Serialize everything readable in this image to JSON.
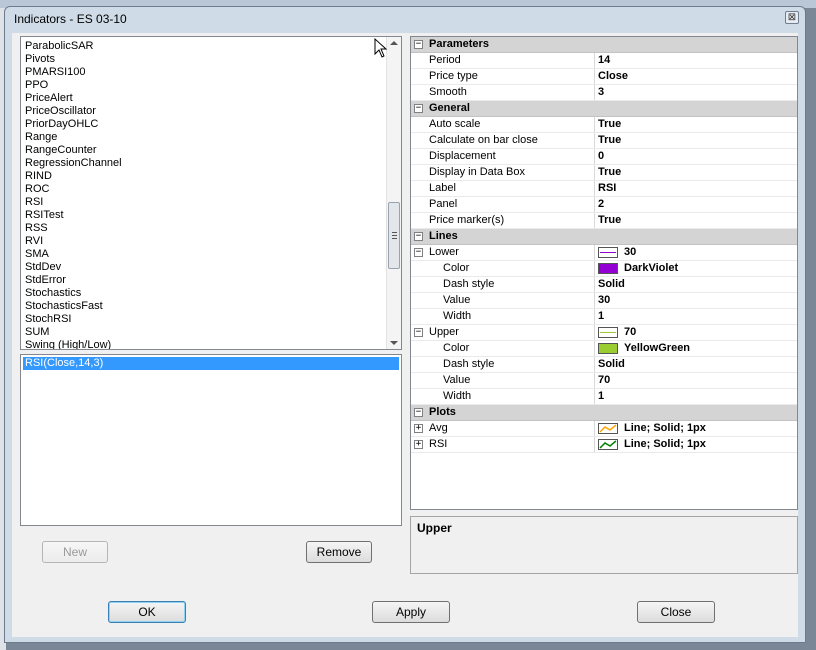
{
  "window": {
    "title": "Indicators - ES 03-10",
    "close_glyph": "⊠"
  },
  "indicator_list": [
    "ParabolicSAR",
    "Pivots",
    "PMARSI100",
    "PPO",
    "PriceAlert",
    "PriceOscillator",
    "PriorDayOHLC",
    "Range",
    "RangeCounter",
    "RegressionChannel",
    "RIND",
    "ROC",
    "RSI",
    "RSITest",
    "RSS",
    "RVI",
    "SMA",
    "StdDev",
    "StdError",
    "Stochastics",
    "StochasticsFast",
    "StochRSI",
    "SUM",
    "Swing (High/Low)"
  ],
  "applied": {
    "items": [
      "RSI(Close,14,3)"
    ]
  },
  "buttons": {
    "new": "New",
    "remove": "Remove",
    "ok": "OK",
    "apply": "Apply",
    "close": "Close"
  },
  "properties": {
    "parameters": {
      "label": "Parameters",
      "rows": [
        {
          "name": "Period",
          "value": "14"
        },
        {
          "name": "Price type",
          "value": "Close"
        },
        {
          "name": "Smooth",
          "value": "3"
        }
      ]
    },
    "general": {
      "label": "General",
      "rows": [
        {
          "name": "Auto scale",
          "value": "True"
        },
        {
          "name": "Calculate on bar close",
          "value": "True"
        },
        {
          "name": "Displacement",
          "value": "0"
        },
        {
          "name": "Display in Data Box",
          "value": "True"
        },
        {
          "name": "Label",
          "value": "RSI"
        },
        {
          "name": "Panel",
          "value": "2"
        },
        {
          "name": "Price marker(s)",
          "value": "True"
        }
      ]
    },
    "lines": {
      "label": "Lines",
      "lower": {
        "name": "Lower",
        "value": "30",
        "line_color": "#9400d3",
        "color": {
          "name": "Color",
          "value": "DarkViolet",
          "hex": "#9400d3"
        },
        "dash": {
          "name": "Dash style",
          "value": "Solid"
        },
        "val": {
          "name": "Value",
          "value": "30"
        },
        "width": {
          "name": "Width",
          "value": "1"
        }
      },
      "upper": {
        "name": "Upper",
        "value": "70",
        "line_color": "#9acd32",
        "color": {
          "name": "Color",
          "value": "YellowGreen",
          "hex": "#9acd32"
        },
        "dash": {
          "name": "Dash style",
          "value": "Solid"
        },
        "val": {
          "name": "Value",
          "value": "70"
        },
        "width": {
          "name": "Width",
          "value": "1"
        }
      }
    },
    "plots": {
      "label": "Plots",
      "avg": {
        "name": "Avg",
        "value": "Line; Solid; 1px",
        "color": "#ffa500"
      },
      "rsi": {
        "name": "RSI",
        "value": "Line; Solid; 1px",
        "color": "#008000"
      }
    }
  },
  "description": {
    "title": "Upper"
  },
  "colors": {
    "selection": "#3399ff",
    "category_bg": "#d4d4d4"
  }
}
